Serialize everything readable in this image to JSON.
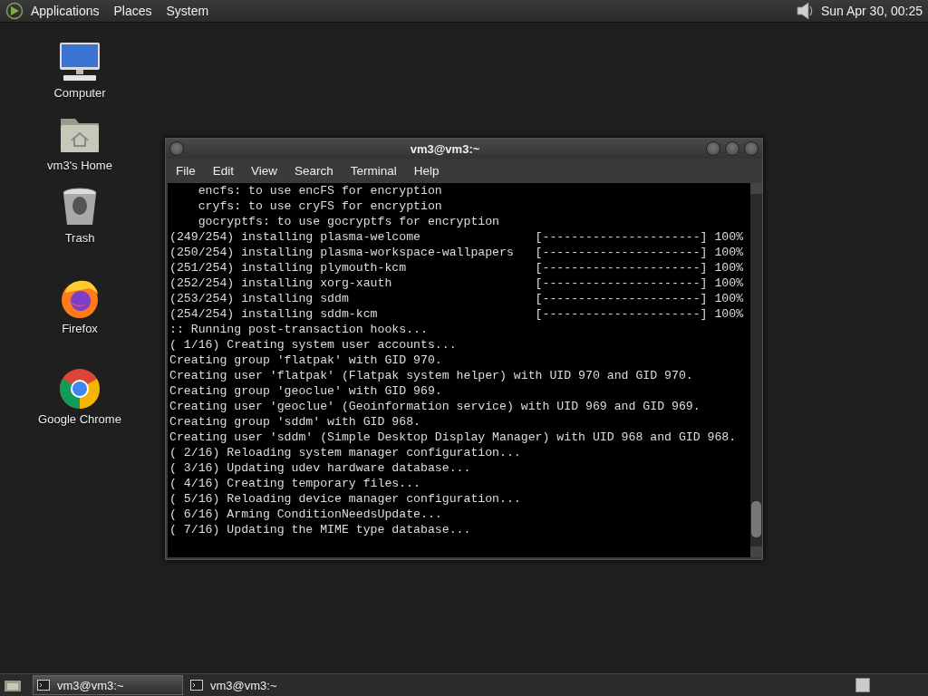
{
  "top_panel": {
    "menus": [
      "Applications",
      "Places",
      "System"
    ],
    "clock": "Sun Apr 30, 00:25"
  },
  "desktop_icons": [
    {
      "label": "Computer",
      "kind": "computer"
    },
    {
      "label": "vm3's Home",
      "kind": "home"
    },
    {
      "label": "Trash",
      "kind": "trash"
    },
    {
      "label": "Firefox",
      "kind": "firefox"
    },
    {
      "label": "Google Chrome",
      "kind": "chrome"
    }
  ],
  "terminal_window": {
    "title": "vm3@vm3:~",
    "menu": [
      "File",
      "Edit",
      "View",
      "Search",
      "Terminal",
      "Help"
    ],
    "lines": [
      "    encfs: to use encFS for encryption",
      "    cryfs: to use cryFS for encryption",
      "    gocryptfs: to use gocryptfs for encryption",
      "(249/254) installing plasma-welcome                [----------------------] 100%",
      "(250/254) installing plasma-workspace-wallpapers   [----------------------] 100%",
      "(251/254) installing plymouth-kcm                  [----------------------] 100%",
      "(252/254) installing xorg-xauth                    [----------------------] 100%",
      "(253/254) installing sddm                          [----------------------] 100%",
      "(254/254) installing sddm-kcm                      [----------------------] 100%",
      ":: Running post-transaction hooks...",
      "( 1/16) Creating system user accounts...",
      "Creating group 'flatpak' with GID 970.",
      "Creating user 'flatpak' (Flatpak system helper) with UID 970 and GID 970.",
      "Creating group 'geoclue' with GID 969.",
      "Creating user 'geoclue' (Geoinformation service) with UID 969 and GID 969.",
      "Creating group 'sddm' with GID 968.",
      "Creating user 'sddm' (Simple Desktop Display Manager) with UID 968 and GID 968.",
      "( 2/16) Reloading system manager configuration...",
      "( 3/16) Updating udev hardware database...",
      "( 4/16) Creating temporary files...",
      "( 5/16) Reloading device manager configuration...",
      "( 6/16) Arming ConditionNeedsUpdate...",
      "( 7/16) Updating the MIME type database..."
    ]
  },
  "taskbar": {
    "tasks": [
      {
        "label": "vm3@vm3:~",
        "selected": true
      },
      {
        "label": "vm3@vm3:~",
        "selected": false
      }
    ]
  }
}
